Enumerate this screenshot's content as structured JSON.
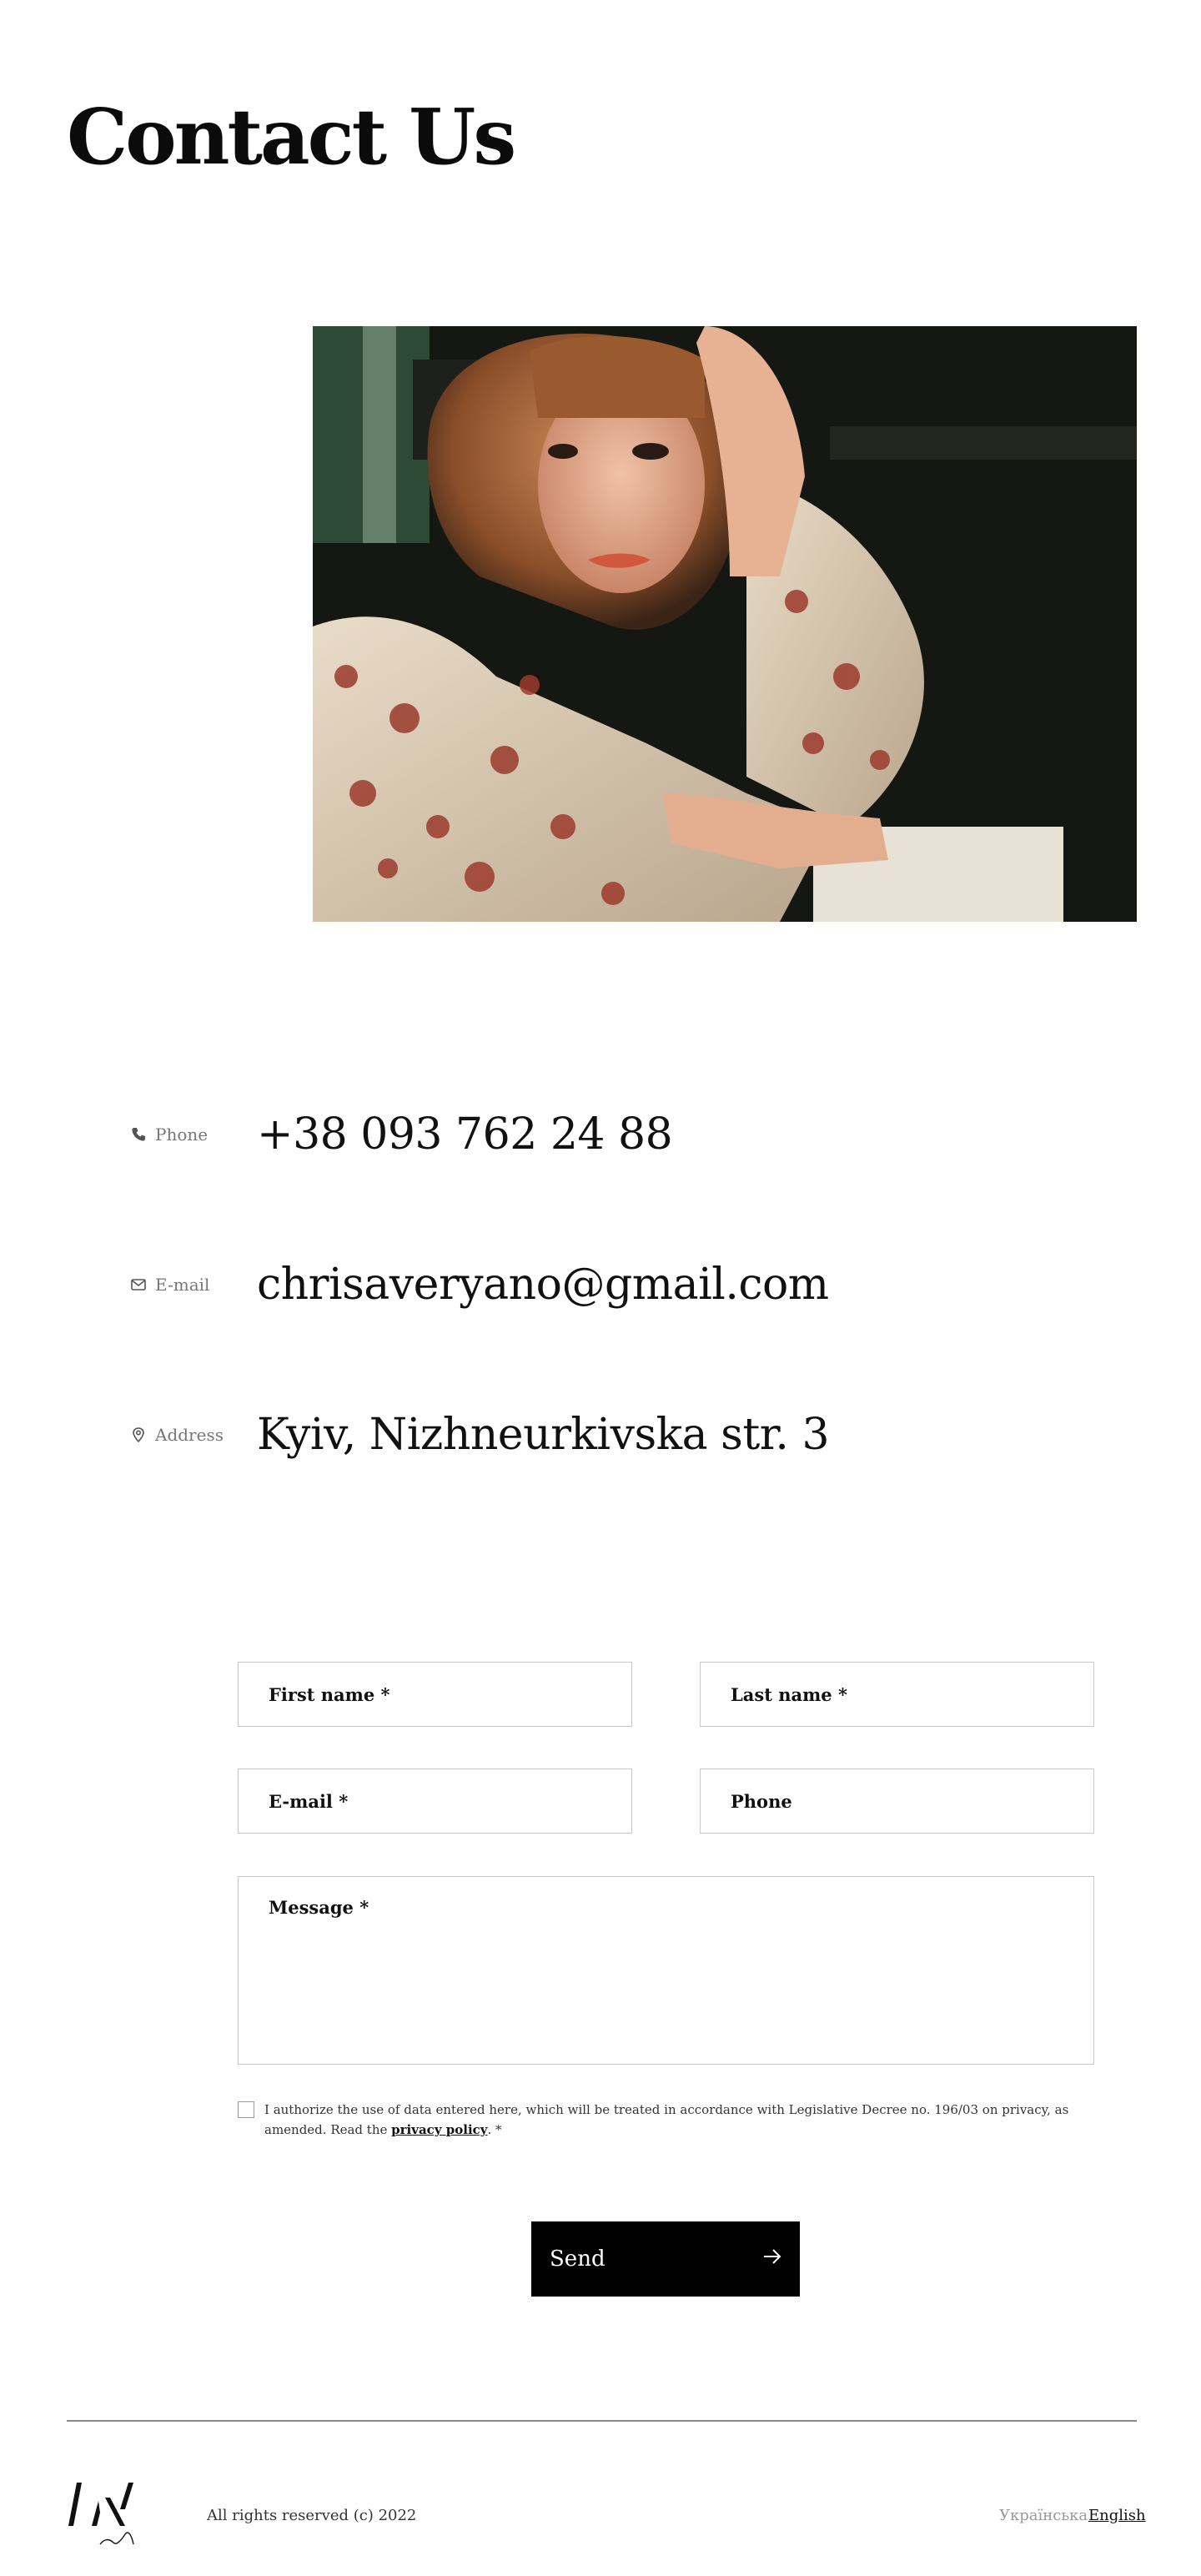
{
  "page": {
    "title": "Contact Us"
  },
  "contacts": [
    {
      "label": "Phone",
      "value": "+38 093 762 24 88",
      "icon": "phone-icon"
    },
    {
      "label": "E-mail",
      "value": "chrisaveryano@gmail.com",
      "icon": "mail-icon"
    },
    {
      "label": "Address",
      "value": "Kyiv, Nizhneurkivska str. 3",
      "icon": "map-pin-icon"
    }
  ],
  "form": {
    "first_name_placeholder": "First name *",
    "last_name_placeholder": "Last name *",
    "email_placeholder": "E-mail *",
    "phone_placeholder": "Phone",
    "message_placeholder": "Message *",
    "consent_text": "I authorize the use of data entered here, which will be treated in accordance with Legislative Decree no. 196/03 on privacy, as amended. Read the",
    "consent_link": "privacy policy",
    "consent_suffix": ". *",
    "send_label": "Send"
  },
  "footer": {
    "copyright": "All rights reserved (c) 2022",
    "languages": [
      {
        "label": "Українська",
        "active": false
      },
      {
        "label": "English",
        "active": true
      }
    ]
  },
  "colors": {
    "button_bg": "#000000",
    "text": "#111111",
    "border": "#c8c8c8"
  }
}
